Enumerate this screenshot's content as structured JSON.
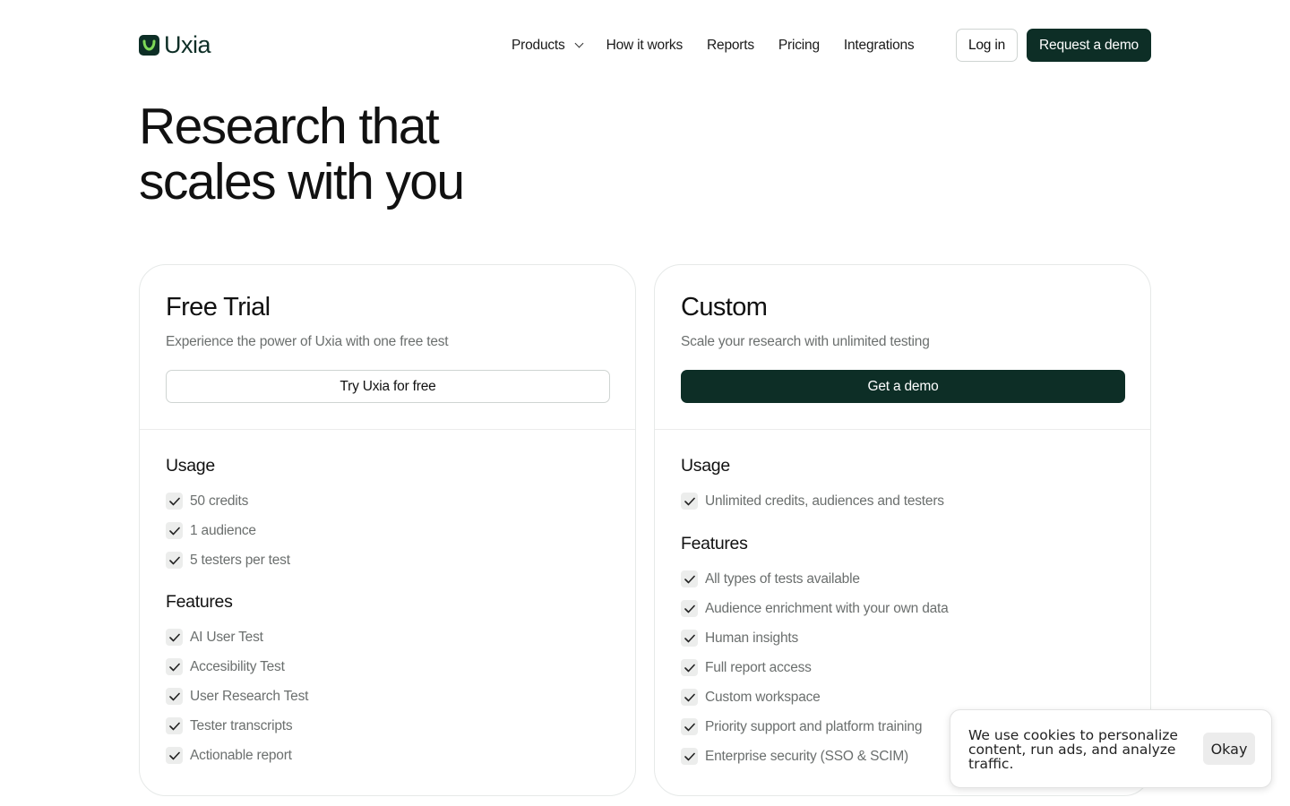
{
  "header": {
    "logo_text": "Uxia",
    "nav": [
      {
        "label": "Products",
        "has_dropdown": true
      },
      {
        "label": "How it works"
      },
      {
        "label": "Reports"
      },
      {
        "label": "Pricing"
      },
      {
        "label": "Integrations"
      }
    ],
    "login_label": "Log in",
    "demo_label": "Request a demo"
  },
  "hero": {
    "title_line1": "Research that",
    "title_line2": "scales with you"
  },
  "plans": [
    {
      "title": "Free Trial",
      "subtitle": "Experience the power of Uxia with one free test",
      "button": "Try Uxia for free",
      "usage_title": "Usage",
      "usage": [
        "50 credits",
        "1 audience",
        "5 testers per test"
      ],
      "features_title": "Features",
      "features": [
        "AI User Test",
        "Accesibility Test",
        "User Research Test",
        "Tester transcripts",
        "Actionable report"
      ]
    },
    {
      "title": "Custom",
      "subtitle": "Scale your research with unlimited testing",
      "button": "Get a demo",
      "usage_title": "Usage",
      "usage": [
        "Unlimited credits, audiences and testers"
      ],
      "features_title": "Features",
      "features": [
        "All types of tests available",
        "Audience enrichment with your own data",
        "Human insights",
        "Full report access",
        "Custom workspace",
        "Priority support and platform training",
        "Enterprise security (SSO & SCIM)"
      ]
    }
  ],
  "cookie": {
    "text": "We use cookies to personalize content, run ads, and analyze traffic.",
    "button": "Okay"
  },
  "colors": {
    "brand_dark": "#0d2e26",
    "logo_accent": "#7ed957",
    "muted_text": "#6b6f6e"
  }
}
